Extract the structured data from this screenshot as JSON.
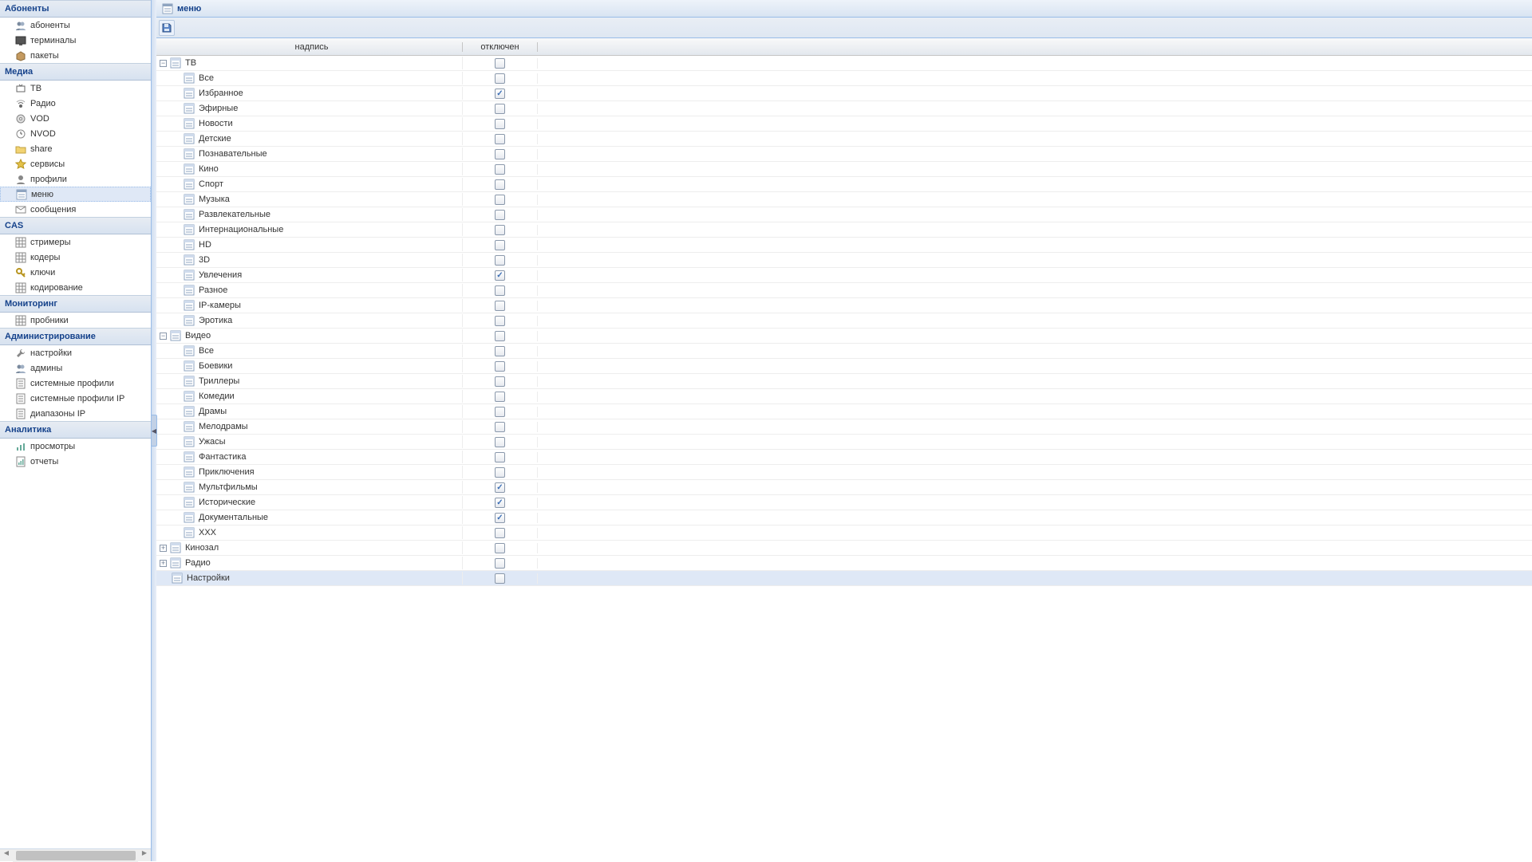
{
  "panel_title": "меню",
  "columns": {
    "label": "надпись",
    "disabled": "отключен"
  },
  "nav": {
    "groups": [
      {
        "title": "Абоненты",
        "items": [
          {
            "id": "subscribers",
            "label": "абоненты",
            "icon": "users",
            "selected": false
          },
          {
            "id": "terminals",
            "label": "терминалы",
            "icon": "terminal",
            "selected": false
          },
          {
            "id": "packages",
            "label": "пакеты",
            "icon": "package",
            "selected": false
          }
        ]
      },
      {
        "title": "Медиа",
        "items": [
          {
            "id": "tv",
            "label": "ТВ",
            "icon": "tv",
            "selected": false
          },
          {
            "id": "radio",
            "label": "Радио",
            "icon": "radio",
            "selected": false
          },
          {
            "id": "vod",
            "label": "VOD",
            "icon": "disc",
            "selected": false
          },
          {
            "id": "nvod",
            "label": "NVOD",
            "icon": "clock",
            "selected": false
          },
          {
            "id": "share",
            "label": "share",
            "icon": "folder",
            "selected": false
          },
          {
            "id": "services",
            "label": "сервисы",
            "icon": "star",
            "selected": false
          },
          {
            "id": "profiles",
            "label": "профили",
            "icon": "profile",
            "selected": false
          },
          {
            "id": "menu",
            "label": "меню",
            "icon": "menu",
            "selected": true
          },
          {
            "id": "messages",
            "label": "сообщения",
            "icon": "message",
            "selected": false
          }
        ]
      },
      {
        "title": "CAS",
        "items": [
          {
            "id": "streamers",
            "label": "стримеры",
            "icon": "grid",
            "selected": false
          },
          {
            "id": "coders",
            "label": "кодеры",
            "icon": "grid",
            "selected": false
          },
          {
            "id": "keys",
            "label": "ключи",
            "icon": "key",
            "selected": false
          },
          {
            "id": "encoding",
            "label": "кодирование",
            "icon": "grid",
            "selected": false
          }
        ]
      },
      {
        "title": "Мониторинг",
        "items": [
          {
            "id": "probes",
            "label": "пробники",
            "icon": "grid",
            "selected": false
          }
        ]
      },
      {
        "title": "Администрирование",
        "items": [
          {
            "id": "settings",
            "label": "настройки",
            "icon": "wrench",
            "selected": false
          },
          {
            "id": "admins",
            "label": "админы",
            "icon": "users",
            "selected": false
          },
          {
            "id": "sysprofiles",
            "label": "системные профили",
            "icon": "form",
            "selected": false
          },
          {
            "id": "sysprofilesip",
            "label": "системные профили IP",
            "icon": "form",
            "selected": false
          },
          {
            "id": "ipranges",
            "label": "диапазоны IP",
            "icon": "form",
            "selected": false
          }
        ]
      },
      {
        "title": "Аналитика",
        "items": [
          {
            "id": "views",
            "label": "просмотры",
            "icon": "chart",
            "selected": false
          },
          {
            "id": "reports",
            "label": "отчеты",
            "icon": "report",
            "selected": false
          }
        ]
      }
    ]
  },
  "tree": [
    {
      "depth": 0,
      "expander": "minus",
      "label": "ТВ",
      "checked": false
    },
    {
      "depth": 1,
      "label": "Все",
      "checked": false
    },
    {
      "depth": 1,
      "label": "Избранное",
      "checked": true
    },
    {
      "depth": 1,
      "label": "Эфирные",
      "checked": false
    },
    {
      "depth": 1,
      "label": "Новости",
      "checked": false
    },
    {
      "depth": 1,
      "label": "Детские",
      "checked": false
    },
    {
      "depth": 1,
      "label": "Познавательные",
      "checked": false
    },
    {
      "depth": 1,
      "label": "Кино",
      "checked": false
    },
    {
      "depth": 1,
      "label": "Спорт",
      "checked": false
    },
    {
      "depth": 1,
      "label": "Музыка",
      "checked": false
    },
    {
      "depth": 1,
      "label": "Развлекательные",
      "checked": false
    },
    {
      "depth": 1,
      "label": "Интернациональные",
      "checked": false
    },
    {
      "depth": 1,
      "label": "HD",
      "checked": false
    },
    {
      "depth": 1,
      "label": "3D",
      "checked": false
    },
    {
      "depth": 1,
      "label": "Увлечения",
      "checked": true
    },
    {
      "depth": 1,
      "label": "Разное",
      "checked": false
    },
    {
      "depth": 1,
      "label": "IP-камеры",
      "checked": false
    },
    {
      "depth": 1,
      "label": "Эротика",
      "checked": false
    },
    {
      "depth": 0,
      "expander": "minus",
      "label": "Видео",
      "checked": false
    },
    {
      "depth": 1,
      "label": "Все",
      "checked": false
    },
    {
      "depth": 1,
      "label": "Боевики",
      "checked": false
    },
    {
      "depth": 1,
      "label": "Триллеры",
      "checked": false
    },
    {
      "depth": 1,
      "label": "Комедии",
      "checked": false
    },
    {
      "depth": 1,
      "label": "Драмы",
      "checked": false
    },
    {
      "depth": 1,
      "label": "Мелодрамы",
      "checked": false
    },
    {
      "depth": 1,
      "label": "Ужасы",
      "checked": false
    },
    {
      "depth": 1,
      "label": "Фантастика",
      "checked": false
    },
    {
      "depth": 1,
      "label": "Приключения",
      "checked": false
    },
    {
      "depth": 1,
      "label": "Мультфильмы",
      "checked": true
    },
    {
      "depth": 1,
      "label": "Исторические",
      "checked": true
    },
    {
      "depth": 1,
      "label": "Документальные",
      "checked": true
    },
    {
      "depth": 1,
      "label": "XXX",
      "checked": false
    },
    {
      "depth": 0,
      "expander": "plus",
      "label": "Кинозал",
      "checked": false
    },
    {
      "depth": 0,
      "expander": "plus",
      "label": "Радио",
      "checked": false
    },
    {
      "depth": 0,
      "expander": "none",
      "label": "Настройки",
      "checked": false,
      "selected": true
    }
  ]
}
